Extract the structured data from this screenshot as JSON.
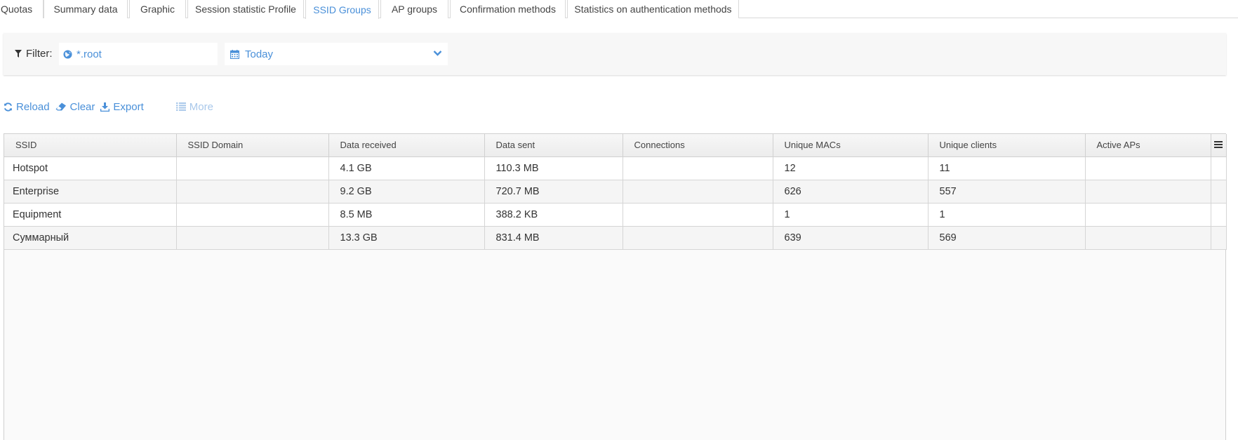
{
  "tabs": [
    {
      "label": "Quotas",
      "active": false
    },
    {
      "label": "Summary data",
      "active": false
    },
    {
      "label": "Graphic",
      "active": false
    },
    {
      "label": "Session statistic Profile",
      "active": false
    },
    {
      "label": "SSID Groups",
      "active": true
    },
    {
      "label": "AP groups",
      "active": false
    },
    {
      "label": "Confirmation methods",
      "active": false
    },
    {
      "label": "Statistics on authentication methods",
      "active": false
    }
  ],
  "filter": {
    "label": "Filter:",
    "scope_value": "*.root",
    "date_value": "Today"
  },
  "toolbar": {
    "reload": "Reload",
    "clear": "Clear",
    "export": "Export",
    "more": "More"
  },
  "table": {
    "columns": [
      "SSID",
      "SSID Domain",
      "Data received",
      "Data sent",
      "Connections",
      "Unique MACs",
      "Unique clients",
      "Active APs"
    ],
    "rows": [
      [
        "Hotspot",
        "",
        "4.1 GB",
        "110.3 MB",
        "",
        "12",
        "11",
        ""
      ],
      [
        "Enterprise",
        "",
        "9.2 GB",
        "720.7 MB",
        "",
        "626",
        "557",
        ""
      ],
      [
        "Equipment",
        "",
        "8.5 MB",
        "388.2 KB",
        "",
        "1",
        "1",
        ""
      ],
      [
        "Суммарный",
        "",
        "13.3 GB",
        "831.4 MB",
        "",
        "639",
        "569",
        ""
      ]
    ]
  },
  "colors": {
    "accent": "#4a90d9",
    "disabled": "#a9c8ea"
  }
}
